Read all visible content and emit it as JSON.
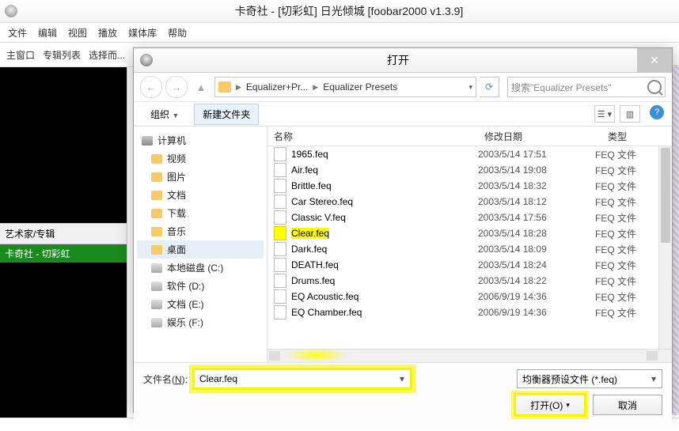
{
  "window": {
    "title": "卡奇社 - [切彩虹] 日光倾城   [foobar2000 v1.3.9]"
  },
  "menu": {
    "file": "文件",
    "edit": "编辑",
    "view": "视图",
    "play": "播放",
    "library": "媒体库",
    "help": "帮助"
  },
  "toolbar": {
    "main": "主窗口",
    "album": "专辑列表",
    "select": "选择而..."
  },
  "artist": {
    "header": "艺术家/专辑",
    "selected": "卡奇社 - 切彩虹"
  },
  "dialog": {
    "title": "打开",
    "breadcrumb": {
      "seg1": "Equalizer+Pr...",
      "seg2": "Equalizer Presets"
    },
    "search_placeholder": "搜索\"Equalizer Presets\"",
    "organize": "组织",
    "newfolder": "新建文件夹",
    "tree": {
      "computer": "计算机",
      "video": "视频",
      "pictures": "图片",
      "documents": "文档",
      "downloads": "下载",
      "music": "音乐",
      "desktop": "桌面",
      "localC": "本地磁盘 (C:)",
      "softD": "软件 (D:)",
      "docE": "文档 (E:)",
      "entF": "娱乐 (F:)"
    },
    "cols": {
      "name": "名称",
      "date": "修改日期",
      "type": "类型"
    },
    "files": [
      {
        "name": "1965.feq",
        "date": "2003/5/14 17:51",
        "type": "FEQ 文件"
      },
      {
        "name": "Air.feq",
        "date": "2003/5/14 19:08",
        "type": "FEQ 文件"
      },
      {
        "name": "Brittle.feq",
        "date": "2003/5/14 18:32",
        "type": "FEQ 文件"
      },
      {
        "name": "Car Stereo.feq",
        "date": "2003/5/14 18:12",
        "type": "FEQ 文件"
      },
      {
        "name": "Classic V.feq",
        "date": "2003/5/14 17:56",
        "type": "FEQ 文件"
      },
      {
        "name": "Clear.feq",
        "date": "2003/5/14 18:28",
        "type": "FEQ 文件",
        "hl": true
      },
      {
        "name": "Dark.feq",
        "date": "2003/5/14 18:09",
        "type": "FEQ 文件"
      },
      {
        "name": "DEATH.feq",
        "date": "2003/5/14 18:24",
        "type": "FEQ 文件"
      },
      {
        "name": "Drums.feq",
        "date": "2003/5/14 18:22",
        "type": "FEQ 文件"
      },
      {
        "name": "EQ Acoustic.feq",
        "date": "2006/9/19 14:36",
        "type": "FEQ 文件"
      },
      {
        "name": "EQ Chamber.feq",
        "date": "2006/9/19 14:36",
        "type": "FEQ 文件"
      }
    ],
    "filename_label_a": "文件名(",
    "filename_label_b": "):",
    "filename_u": "N",
    "filename_value": "Clear.feq",
    "filter": "均衡器预设文件 (*.feq)",
    "open": "打开(O)",
    "cancel": "取消"
  }
}
